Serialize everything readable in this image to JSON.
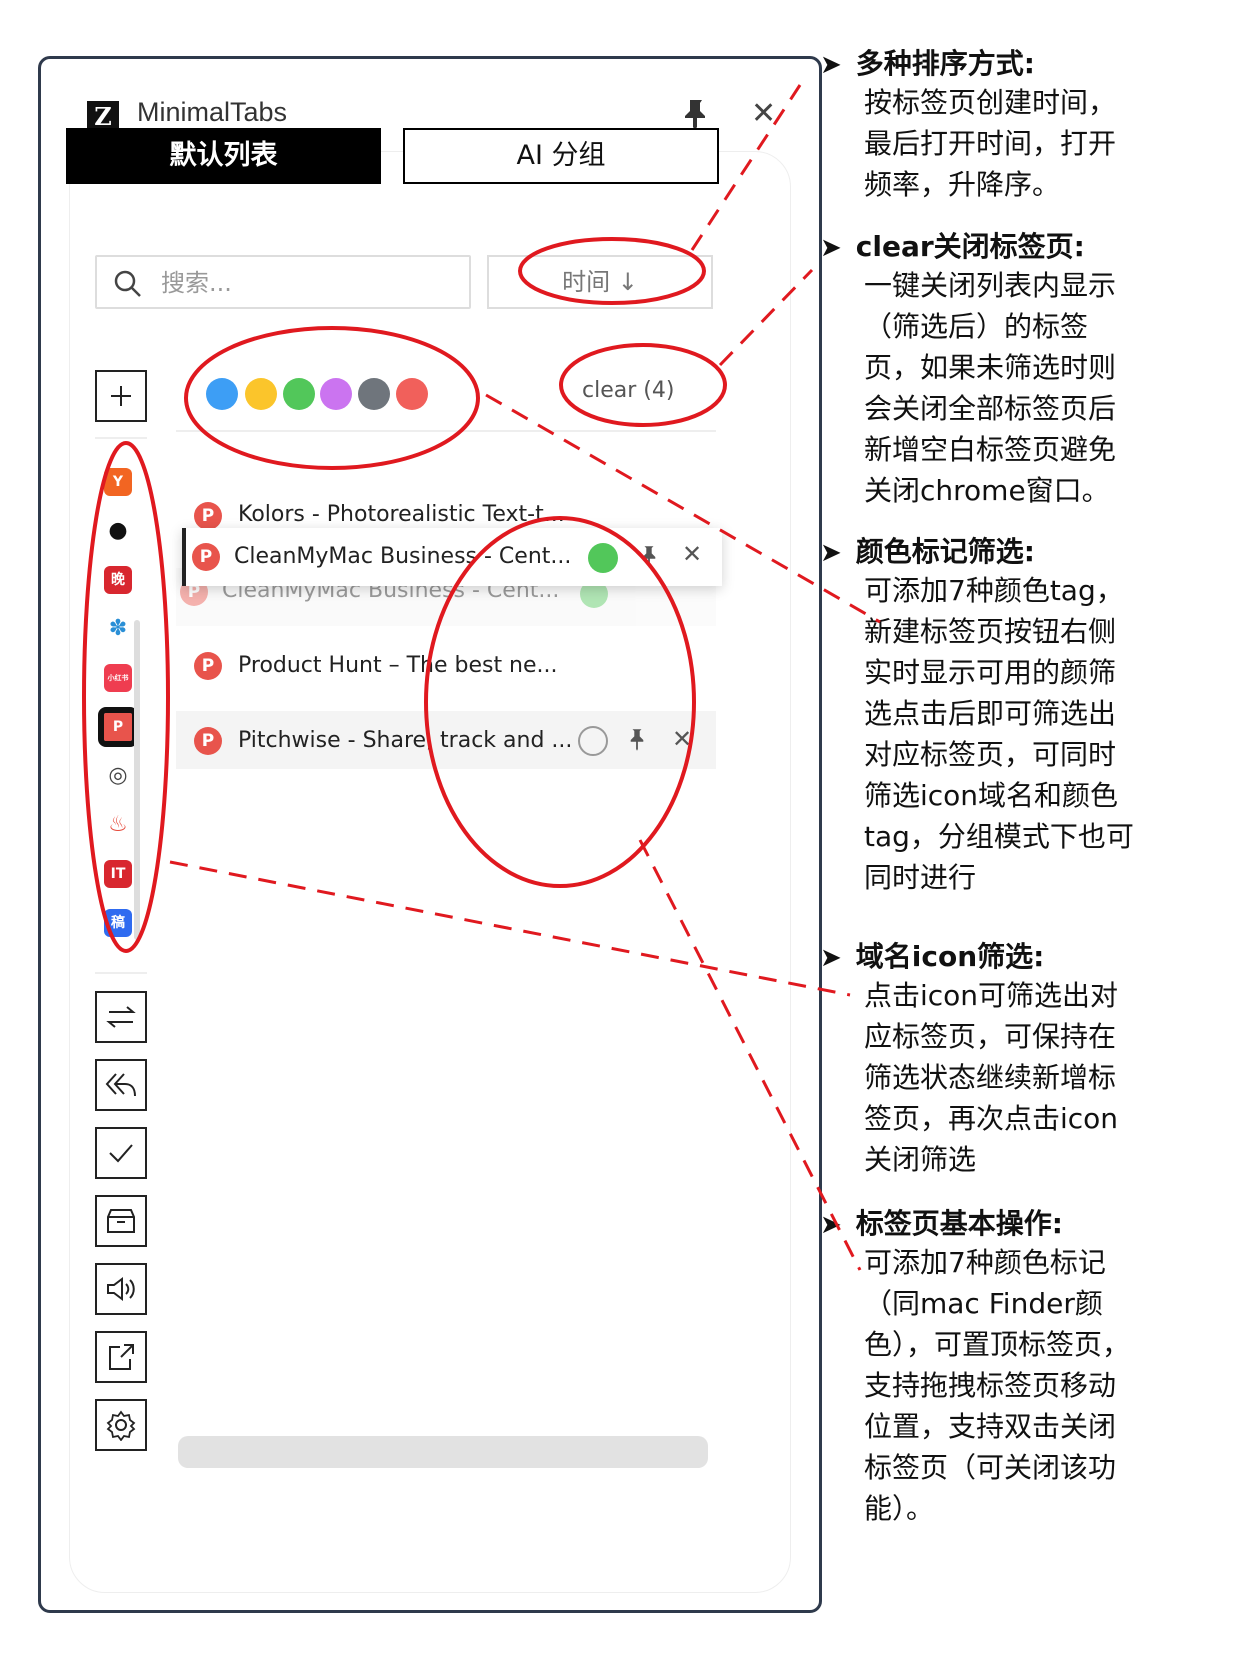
{
  "app": {
    "title": "MinimalTabs",
    "logo_letter": "Z"
  },
  "tabs": {
    "default_label": "默认列表",
    "ai_label": "AI 分组"
  },
  "search": {
    "placeholder": "搜索..."
  },
  "sort": {
    "label": "时间 ↓"
  },
  "colors": [
    "#3d9ef5",
    "#fbc52b",
    "#52c75a",
    "#cb74f0",
    "#6f757c",
    "#f1605b"
  ],
  "clear_label": "clear (4)",
  "tab_list": [
    {
      "title": "Kolors - Photorealistic Text-t..."
    },
    {
      "title": "CleanMyMac Business - Cent...",
      "dragging": true,
      "color": "#52c75a"
    },
    {
      "title": "CleanMyMac Business - Cent..."
    },
    {
      "title": "Product Hunt – The best ne..."
    },
    {
      "title": "Pitchwise - Share, track and ..."
    }
  ],
  "sidebar_favicons": [
    {
      "icon": "ycombinator-icon",
      "text": "Y",
      "bg": "#f26522"
    },
    {
      "icon": "github-icon",
      "text": "",
      "bg": "#ffffff"
    },
    {
      "icon": "wan-icon",
      "text": "晚",
      "bg": "#d8272f"
    },
    {
      "icon": "tree-icon",
      "text": "",
      "bg": "#ffffff"
    },
    {
      "icon": "xiaohongshu-icon",
      "text": "小红书",
      "bg": "#ef3d50"
    },
    {
      "icon": "producthunt-icon",
      "text": "P",
      "bg": "#e8544c"
    },
    {
      "icon": "chrome-icon",
      "text": "",
      "bg": "#ffffff"
    },
    {
      "icon": "popcorn-icon",
      "text": "",
      "bg": "#ffffff"
    },
    {
      "icon": "ithome-icon",
      "text": "IT",
      "bg": "#d8272f"
    },
    {
      "icon": "gao-icon",
      "text": "稿",
      "bg": "#2f6bf0"
    }
  ],
  "annotations": [
    {
      "title": "多种排序方式:",
      "body": "按标签页创建时间，最后打开时间，打开频率，升降序。"
    },
    {
      "title": "clear关闭标签页:",
      "body": "一键关闭列表内显示（筛选后）的标签页，如果未筛选时则会关闭全部标签页后新增空白标签页避免关闭chrome窗口。"
    },
    {
      "title": "颜色标记筛选:",
      "body": "可添加7种颜色tag，新建标签页按钮右侧实时显示可用的颜筛选点击后即可筛选出对应标签页，可同时筛选icon域名和颜色tag，分组模式下也可同时进行"
    },
    {
      "title": "域名icon筛选:",
      "body": "点击icon可筛选出对应标签页，可保持在筛选状态继续新增标签页，再次点击icon关闭筛选"
    },
    {
      "title": "标签页基本操作:",
      "body": "可添加7种颜色标记（同mac Finder颜色），可置顶标签页，支持拖拽标签页移动位置，支持双击关闭标签页（可关闭该功能）。"
    }
  ],
  "annotation_color": "#e0191f"
}
